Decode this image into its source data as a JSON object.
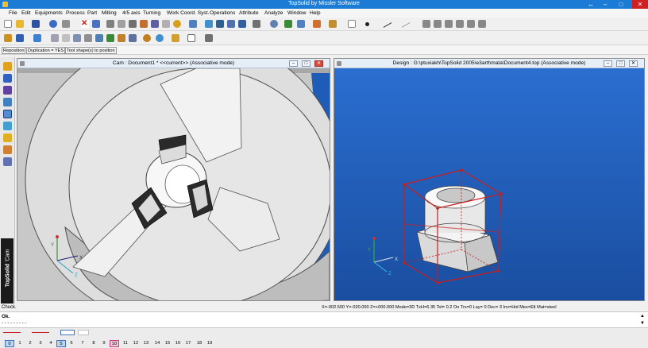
{
  "window": {
    "title": "TopSolid by Missler Software",
    "minimize": "–",
    "maximize": "□",
    "close": "✕",
    "extra": "↔"
  },
  "menu": [
    "File",
    "Edit",
    "Equipments",
    "Process",
    "Part",
    "Milling",
    "4/5 axis",
    "Turning",
    "Work Coord. Syst.",
    "Operations",
    "Attribute",
    "Analyze",
    "Window",
    "Help"
  ],
  "options": {
    "reposition": "Reposition",
    "duplication": "Duplication = YES",
    "tool_shape": "Tool shape(s) to position"
  },
  "cam_window": {
    "title": "Cam : Document1 *  <<current>>  (Associative mode)"
  },
  "design_window": {
    "title": "Design : G:\\ptuxiakh\\TopSolid 2005\\e3arthmata\\Document4.top  (Associative mode)"
  },
  "brand": {
    "bold": "TopSolid",
    "rest": "'Cam"
  },
  "status": {
    "chuck": "Chuck.",
    "coords": "X=-002.500  Y=-020.000  Z=+000.000  Mode=3D  TxH=6.35  Tol=  0.2   On  Trs=0   Lay=  0   Dec= 3   Inv=Hid  Mes=Elt  Mat=steel"
  },
  "messages": {
    "line1": "Ok.",
    "line2": "- - - - - - - - -"
  },
  "layers": [
    "0",
    "1",
    "2",
    "3",
    "4",
    "5",
    "6",
    "7",
    "8",
    "9",
    "10",
    "11",
    "12",
    "13",
    "14",
    "15",
    "16",
    "17",
    "18",
    "19"
  ],
  "colors": {
    "titlebar": "#1c7cd5",
    "viewport_blue": "#1e5cb8",
    "wire_red": "#c81e1e"
  }
}
